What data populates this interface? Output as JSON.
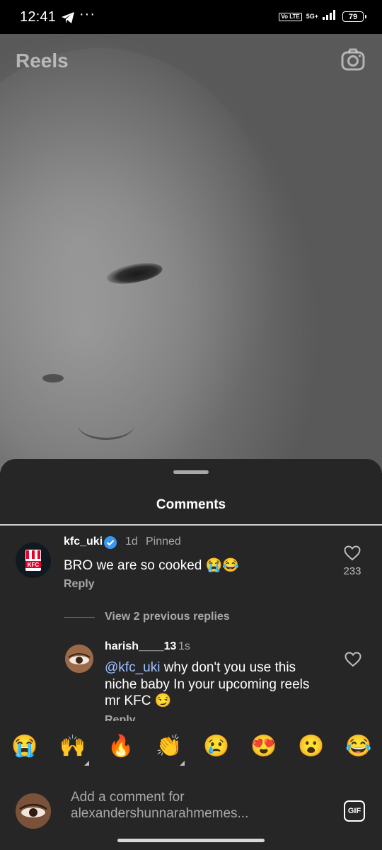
{
  "status_bar": {
    "time": "12:41",
    "dots": "···",
    "volte": "Vo LTE",
    "network": "5G+",
    "battery": "79"
  },
  "header": {
    "title": "Reels",
    "camera_icon": "camera-icon"
  },
  "comments_sheet": {
    "title": "Comments",
    "pinned_comment": {
      "username": "kfc_uki",
      "time": "1d",
      "pinned_label": "Pinned",
      "text": "BRO we are so cooked 😭😂",
      "reply_label": "Reply",
      "likes": "233"
    },
    "view_replies": "View 2 previous replies",
    "reply_comment": {
      "username": "harish____13",
      "time": "1s",
      "mention": "@kfc_uki",
      "text": " why don't you use this niche baby In your upcoming reels mr KFC 😏",
      "reply_label": "Reply"
    }
  },
  "emoji_bar": [
    "😭",
    "🙌",
    "🔥",
    "👏",
    "😢",
    "😍",
    "😮",
    "😂"
  ],
  "comment_input": {
    "placeholder_line1": "Add a comment for",
    "placeholder_line2": "alexandershunnarahmemes...",
    "gif_label": "GIF"
  },
  "colors": {
    "sheet_bg": "#262626",
    "secondary_text": "#a8a8a8",
    "mention": "#9ec1ff",
    "verified": "#3897f0"
  }
}
